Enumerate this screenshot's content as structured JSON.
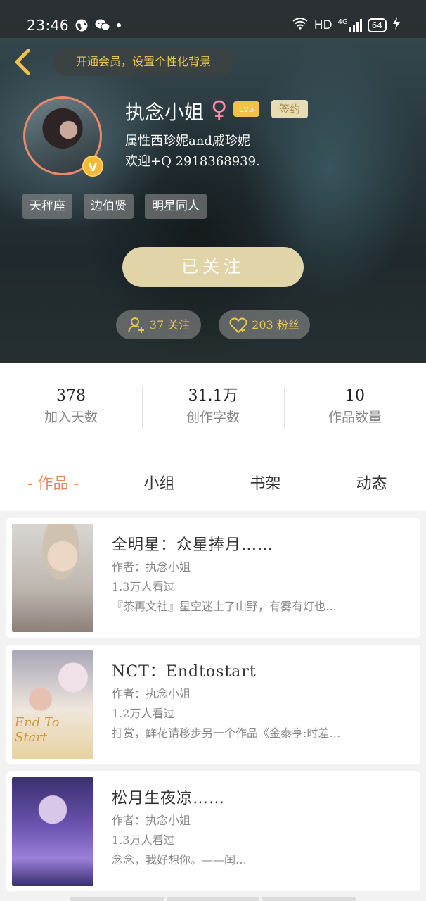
{
  "status_bar": {
    "time": "23:46",
    "icons": [
      "globe-icon",
      "wechat-icon",
      "dot-icon"
    ],
    "right": {
      "hd": "HD",
      "net": "4G",
      "battery": "64"
    }
  },
  "header": {
    "vip_prompt": "开通会员，设置个性化背景"
  },
  "profile": {
    "name": "执念小姐",
    "gender_symbol": "♀",
    "level": "Lv5",
    "sign_badge": "签约",
    "bio_line1": "属性西珍妮and戚珍妮",
    "bio_line2": "欢迎+Q 2918368939.",
    "tags": [
      "天秤座",
      "边伯贤",
      "明星同人"
    ],
    "follow_button": "已关注",
    "following": "37 关注",
    "fans": "203 粉丝"
  },
  "stats": [
    {
      "value": "378",
      "label": "加入天数"
    },
    {
      "value": "31.1万",
      "label": "创作字数"
    },
    {
      "value": "10",
      "label": "作品数量"
    }
  ],
  "tabs": [
    {
      "label": "- 作品 -",
      "active": true
    },
    {
      "label": "小组",
      "active": false
    },
    {
      "label": "书架",
      "active": false
    },
    {
      "label": "动态",
      "active": false
    }
  ],
  "works": [
    {
      "title": "全明星：众星捧月……",
      "author": "作者：执念小姐",
      "views": "1.3万人看过",
      "desc": "『茶再文社』星空迷上了山野，有雾有灯也…"
    },
    {
      "title": "NCT：Endtostart",
      "author": "作者：执念小姐",
      "views": "1.2万人看过",
      "desc": "打赏，鲜花请移步另一个作品《金泰亨:时差…",
      "cover_text": "End To Start"
    },
    {
      "title": "松月生夜凉……",
      "author": "作者：执念小姐",
      "views": "1.3万人看过",
      "desc": "念念，我好想你。——闰…"
    }
  ],
  "colors": {
    "accent": "#e7865e",
    "gold": "#e8c64e",
    "follow_button_bg": "#e2d4a9"
  }
}
